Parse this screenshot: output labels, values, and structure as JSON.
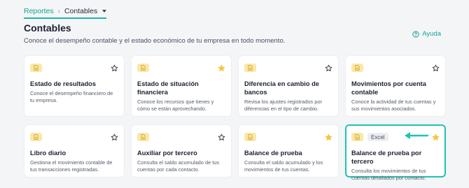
{
  "breadcrumb": {
    "root": "Reportes",
    "current": "Contables"
  },
  "page": {
    "title": "Contables",
    "subtitle": "Conoce el desempeño contable y el estado económico de tu empresa en todo momento.",
    "help_label": "Ayuda"
  },
  "colors": {
    "accent": "#1fb5a5",
    "star_filled": "#f5c542",
    "icon_bg": "#fbe8a6"
  },
  "cards": [
    {
      "title": "Estado de resultados",
      "desc": "Conoce el desempeño financiero de tu empresa.",
      "starred": false,
      "tag": ""
    },
    {
      "title": "Estado de situación financiera",
      "desc": "Conoce los recursos que tienes y cómo se están aprovechando.",
      "starred": true,
      "tag": ""
    },
    {
      "title": "Diferencia en cambio de bancos",
      "desc": "Revisa los ajustes registrados por diferencias en el tipo de cambio.",
      "starred": false,
      "tag": ""
    },
    {
      "title": "Movimientos por cuenta contable",
      "desc": "Conoce la actividad de tus cuentas y sus movimientos asociados.",
      "starred": false,
      "tag": ""
    },
    {
      "title": "Libro diario",
      "desc": "Gestiona el movimiento contable de tus transacciones registradas.",
      "starred": false,
      "tag": ""
    },
    {
      "title": "Auxiliar por tercero",
      "desc": "Consulta el saldo acumulado de tus cuentas por cada contacto.",
      "starred": false,
      "tag": ""
    },
    {
      "title": "Balance de prueba",
      "desc": "Consulta el saldo acumulado y los movimientos de tus cuentas.",
      "starred": true,
      "tag": ""
    },
    {
      "title": "Balance de prueba por tercero",
      "desc": "Consulta los movimientos de tus cuentas detallados por contacto.",
      "starred": true,
      "tag": "Excel",
      "selected": true
    }
  ]
}
